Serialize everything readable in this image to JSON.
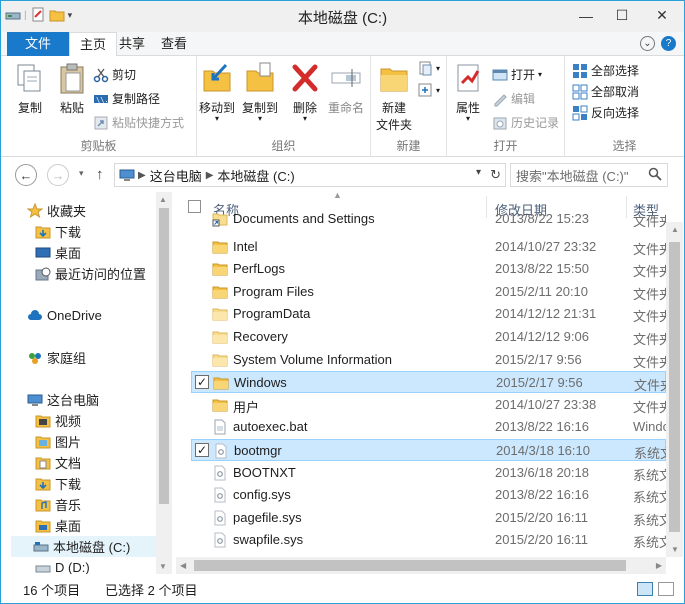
{
  "window": {
    "title": "本地磁盘 (C:)"
  },
  "ribbon_tabs": {
    "file": "文件",
    "home": "主页",
    "share": "共享",
    "view": "查看"
  },
  "ribbon": {
    "clipboard": {
      "copy": "复制",
      "paste": "粘贴",
      "cut": "剪切",
      "copy_path": "复制路径",
      "paste_shortcut": "粘贴快捷方式",
      "label": "剪贴板"
    },
    "organize": {
      "move_to": "移动到",
      "copy_to": "复制到",
      "delete": "删除",
      "rename": "重命名",
      "label": "组织"
    },
    "new": {
      "new_folder_line1": "新建",
      "new_folder_line2": "文件夹",
      "label": "新建"
    },
    "open": {
      "properties": "属性",
      "open": "打开",
      "edit": "编辑",
      "history": "历史记录",
      "label": "打开"
    },
    "select": {
      "select_all": "全部选择",
      "select_none": "全部取消",
      "invert": "反向选择",
      "label": "选择"
    }
  },
  "address": {
    "this_pc": "这台电脑",
    "drive": "本地磁盘 (C:)",
    "search_placeholder": "搜索\"本地磁盘 (C:)\""
  },
  "nav": {
    "favorites": "收藏夹",
    "downloads": "下载",
    "desktop": "桌面",
    "recent": "最近访问的位置",
    "onedrive": "OneDrive",
    "homegroup": "家庭组",
    "this_pc": "这台电脑",
    "videos": "视频",
    "pictures": "图片",
    "documents": "文档",
    "downloads2": "下载",
    "music": "音乐",
    "desktop2": "桌面",
    "drive_c": "本地磁盘 (C:)",
    "drive_d": "D (D:)"
  },
  "columns": {
    "name": "名称",
    "date": "修改日期",
    "type": "类型"
  },
  "files": [
    {
      "name": "Documents and Settings",
      "date": "2013/8/22 15:23",
      "type": "文件夹",
      "icon": "shortcut-folder",
      "selected": false
    },
    {
      "name": "Intel",
      "date": "2014/10/27 23:32",
      "type": "文件夹",
      "icon": "folder",
      "selected": false
    },
    {
      "name": "PerfLogs",
      "date": "2013/8/22 15:50",
      "type": "文件夹",
      "icon": "folder",
      "selected": false
    },
    {
      "name": "Program Files",
      "date": "2015/2/11 20:10",
      "type": "文件夹",
      "icon": "folder",
      "selected": false
    },
    {
      "name": "ProgramData",
      "date": "2014/12/12 21:31",
      "type": "文件夹",
      "icon": "folder-light",
      "selected": false
    },
    {
      "name": "Recovery",
      "date": "2014/12/12 9:06",
      "type": "文件夹",
      "icon": "folder-light",
      "selected": false
    },
    {
      "name": "System Volume Information",
      "date": "2015/2/17 9:56",
      "type": "文件夹",
      "icon": "folder-light",
      "selected": false
    },
    {
      "name": "Windows",
      "date": "2015/2/17 9:56",
      "type": "文件夹",
      "icon": "folder",
      "selected": true
    },
    {
      "name": "用户",
      "date": "2014/10/27 23:38",
      "type": "文件夹",
      "icon": "folder",
      "selected": false
    },
    {
      "name": "autoexec.bat",
      "date": "2013/8/22 16:16",
      "type": "Windows",
      "icon": "file",
      "selected": false
    },
    {
      "name": "bootmgr",
      "date": "2014/3/18 16:10",
      "type": "系统文件",
      "icon": "sysfile",
      "selected": true
    },
    {
      "name": "BOOTNXT",
      "date": "2013/6/18 20:18",
      "type": "系统文件",
      "icon": "sysfile",
      "selected": false
    },
    {
      "name": "config.sys",
      "date": "2013/8/22 16:16",
      "type": "系统文件",
      "icon": "sysfile",
      "selected": false
    },
    {
      "name": "pagefile.sys",
      "date": "2015/2/20 16:11",
      "type": "系统文件",
      "icon": "sysfile",
      "selected": false
    },
    {
      "name": "swapfile.sys",
      "date": "2015/2/20 16:11",
      "type": "系统文件",
      "icon": "sysfile",
      "selected": false
    }
  ],
  "status": {
    "count": "16 个项目",
    "selected": "已选择 2 个项目"
  },
  "colors": {
    "accent": "#1979ca",
    "selection": "#cce8ff",
    "folder": "#f5c142"
  }
}
